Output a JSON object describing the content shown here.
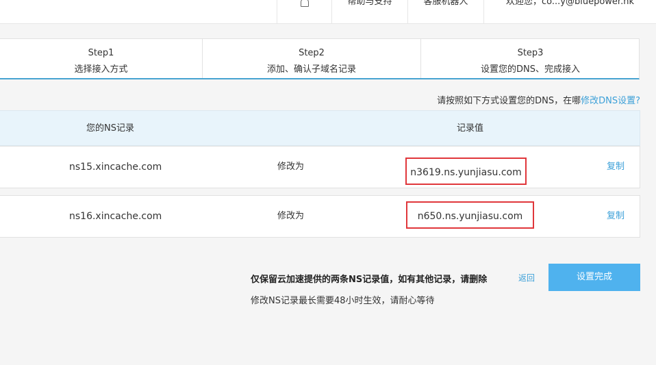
{
  "header": {
    "nav": [
      {
        "icon": "bell-icon",
        "label": ""
      },
      {
        "label": "帮助与支持"
      },
      {
        "label": "客服机器人"
      },
      {
        "label": "欢迎您，co...y@bluepower.hk"
      }
    ]
  },
  "steps": [
    {
      "title": "Step1",
      "desc": "选择接入方式"
    },
    {
      "title": "Step2",
      "desc": "添加、确认子域名记录"
    },
    {
      "title": "Step3",
      "desc": "设置您的DNS、完成接入"
    }
  ],
  "instruction": {
    "text": "请按照如下方式设置您的DNS，在哪",
    "link": "修改DNS设置?"
  },
  "table": {
    "headers": {
      "ns": "您的NS记录",
      "value": "记录值"
    },
    "rows": [
      {
        "ns": "ns15.xincache.com",
        "action": "修改为",
        "value": "n3619.ns.yunjiasu.com",
        "copy": "复制"
      },
      {
        "ns": "ns16.xincache.com",
        "action": "修改为",
        "value": "n650.ns.yunjiasu.com",
        "copy": "复制"
      }
    ]
  },
  "footer": {
    "notice": "仅保留云加速提供的两条NS记录值，如有其他记录，请删除",
    "sub_notice": "修改NS记录最长需要48小时生效，请耐心等待",
    "back": "返回",
    "done": "设置完成"
  },
  "colors": {
    "accent": "#4fb2ee",
    "link": "#3ca0d8",
    "highlight_border": "#e0363a",
    "header_bg": "#e8f4fb"
  }
}
